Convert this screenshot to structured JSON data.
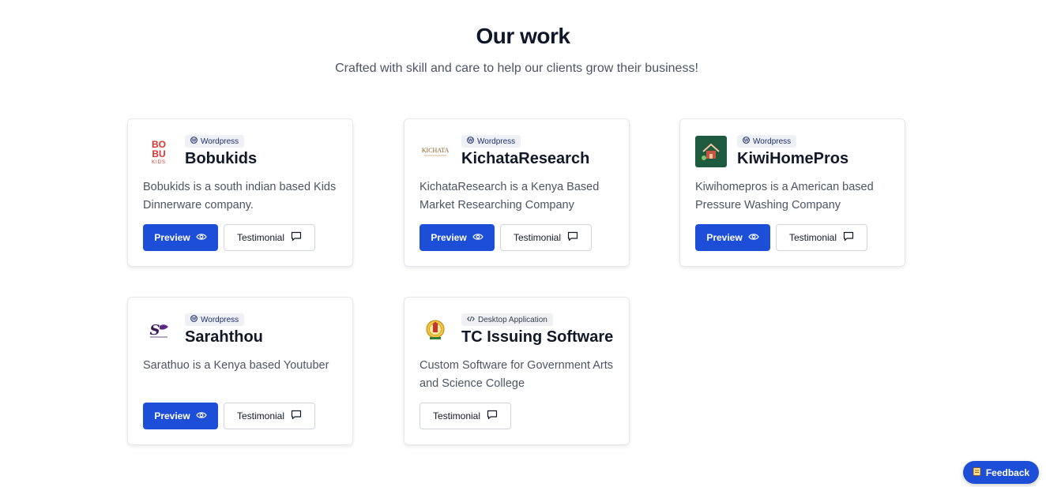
{
  "header": {
    "title": "Our work",
    "subtitle": "Crafted with skill and care to help our clients grow their business!"
  },
  "projects": [
    {
      "category": "Wordpress",
      "name": "Bobukids",
      "description": "Bobukids is a south indian based Kids Dinnerware company.",
      "logo_text": [
        "BO",
        "BU",
        "KIDS"
      ],
      "preview_label": "Preview",
      "testimonial_label": "Testimonial"
    },
    {
      "category": "Wordpress",
      "name": "KichataResearch",
      "description": "KichataResearch is a Kenya Based Market Researching Company",
      "logo_text": [
        "KICHATA"
      ],
      "preview_label": "Preview",
      "testimonial_label": "Testimonial"
    },
    {
      "category": "Wordpress",
      "name": "KiwiHomePros",
      "description": "Kiwihomepros is a American based Pressure Washing Company",
      "preview_label": "Preview",
      "testimonial_label": "Testimonial"
    },
    {
      "category": "Wordpress",
      "name": "Sarahthou",
      "description": "Sarathuo is a Kenya based Youtuber",
      "logo_text": [
        "S"
      ],
      "preview_label": "Preview",
      "testimonial_label": "Testimonial"
    },
    {
      "category": "Desktop Application",
      "name": "TC Issuing Software",
      "description": "Custom Software for Government Arts and Science College",
      "testimonial_label": "Testimonial"
    }
  ],
  "feedback_label": "Feedback",
  "colors": {
    "accent": "#1d4ed8",
    "title": "#0f172a",
    "muted_text": "#4b5563",
    "badge_bg": "#eef1f6",
    "bobu_red": "#e0322e",
    "kiwi_green": "#1d5a3e"
  },
  "icons": {
    "wordpress": "wordpress-icon",
    "code": "code-icon",
    "eye": "eye-icon",
    "chat": "chat-bubble-icon",
    "note": "clipboard-icon"
  }
}
